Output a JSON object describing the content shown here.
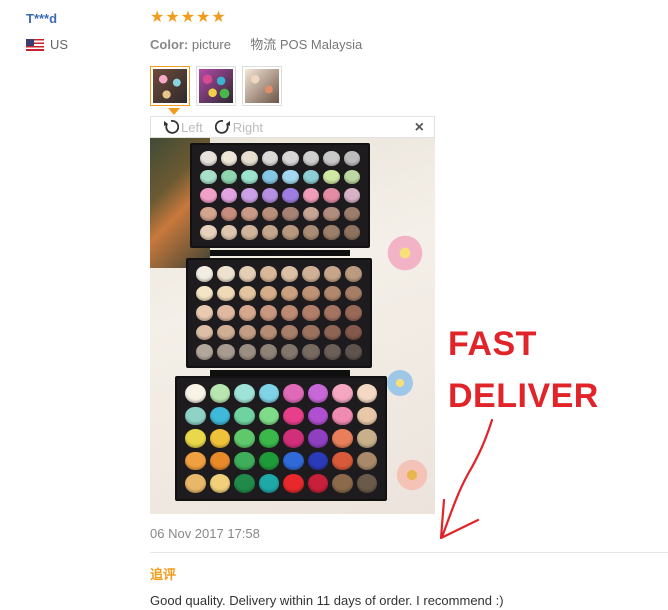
{
  "reviewer": {
    "name": "T***d",
    "country": "US"
  },
  "rating": {
    "stars": 5,
    "max": 5
  },
  "meta": {
    "color_label": "Color:",
    "color_value": "picture",
    "shipping_label": "物流",
    "shipping_value": "POS Malaysia"
  },
  "thumbnails": [
    {
      "name": "thumbnail-1",
      "active": true
    },
    {
      "name": "thumbnail-2",
      "active": false
    },
    {
      "name": "thumbnail-3",
      "active": false
    }
  ],
  "viewer": {
    "rotate_left": "Left",
    "rotate_right": "Right",
    "close": "×"
  },
  "annotation": {
    "line1": "FAST",
    "line2": "DELIVER"
  },
  "review": {
    "date": "06 Nov 2017 17:58",
    "followup_label": "追评",
    "text": "Good quality. Delivery within 11 days of order. I recommend :)"
  },
  "colors": {
    "accent": "#f29c1f",
    "link": "#3b6ab5",
    "annotation": "#e0242a"
  },
  "palettes": {
    "top": [
      "#e8e1dc",
      "#efe7d9",
      "#e7e0d0",
      "#dcdad6",
      "#d8d6d6",
      "#cfcfcf",
      "#c9c9c9",
      "#bcbcbc",
      "#a8e0c9",
      "#8fd6b1",
      "#9ee3cf",
      "#85c8e6",
      "#a4d8f0",
      "#8dcfd5",
      "#d0e8a3",
      "#bcd7a2",
      "#f1a1c8",
      "#e3a3e0",
      "#cba0e6",
      "#b58fe0",
      "#9f7ee2",
      "#f09cb9",
      "#e58ca5",
      "#d7b2c6",
      "#d3a48e",
      "#c68c7d",
      "#c99a86",
      "#b98e7a",
      "#a68276",
      "#c7a594",
      "#b18d7d",
      "#9c7d6c",
      "#e7d3bd",
      "#dec7ae",
      "#cfb49b",
      "#c4a68c",
      "#b7987f",
      "#a88c75",
      "#9b7f6a",
      "#8e725f"
    ],
    "middle": [
      "#f2ede2",
      "#ece2cf",
      "#e4cfb4",
      "#d9b89a",
      "#dcc0a6",
      "#cfb096",
      "#c7a58a",
      "#bb9a80",
      "#f4e6c4",
      "#efd9b6",
      "#e3c3a0",
      "#d6ad89",
      "#caa07f",
      "#bd9275",
      "#b1886e",
      "#a67e66",
      "#e9c9b0",
      "#e0b9a0",
      "#d5a88e",
      "#c9977f",
      "#bd8a74",
      "#b17e6a",
      "#a57361",
      "#996958",
      "#dcbfa6",
      "#cfae94",
      "#c29d84",
      "#b58d76",
      "#a87f6a",
      "#9b725f",
      "#8e6555",
      "#82594b",
      "#b3a79b",
      "#a79a8e",
      "#9b8e82",
      "#8f8277",
      "#83766c",
      "#776a61",
      "#6b5f57",
      "#5f544d"
    ],
    "bottom": [
      "#f8f3e6",
      "#b9e6b0",
      "#9fe3d8",
      "#7fd3e6",
      "#e06ab8",
      "#c868d8",
      "#f5a6c0",
      "#f3d9c4",
      "#8fd3c6",
      "#3fb9d9",
      "#6fd39f",
      "#7fdc8a",
      "#e83f8a",
      "#b04fd0",
      "#f08ab0",
      "#e8c8a8",
      "#e8d84a",
      "#f0c23a",
      "#5fc86a",
      "#3ab84a",
      "#d22f7a",
      "#8f3fc0",
      "#e87f5a",
      "#c8b08a",
      "#f0a040",
      "#e88a2a",
      "#3fae5a",
      "#1f9a3a",
      "#2f6ad8",
      "#2a3ab8",
      "#d85a3a",
      "#a88a6a",
      "#e8b86a",
      "#f0d07a",
      "#1f8a4a",
      "#1fa8a8",
      "#e8282a",
      "#c81f3a",
      "#8a6a4a",
      "#6a5a4a"
    ]
  }
}
